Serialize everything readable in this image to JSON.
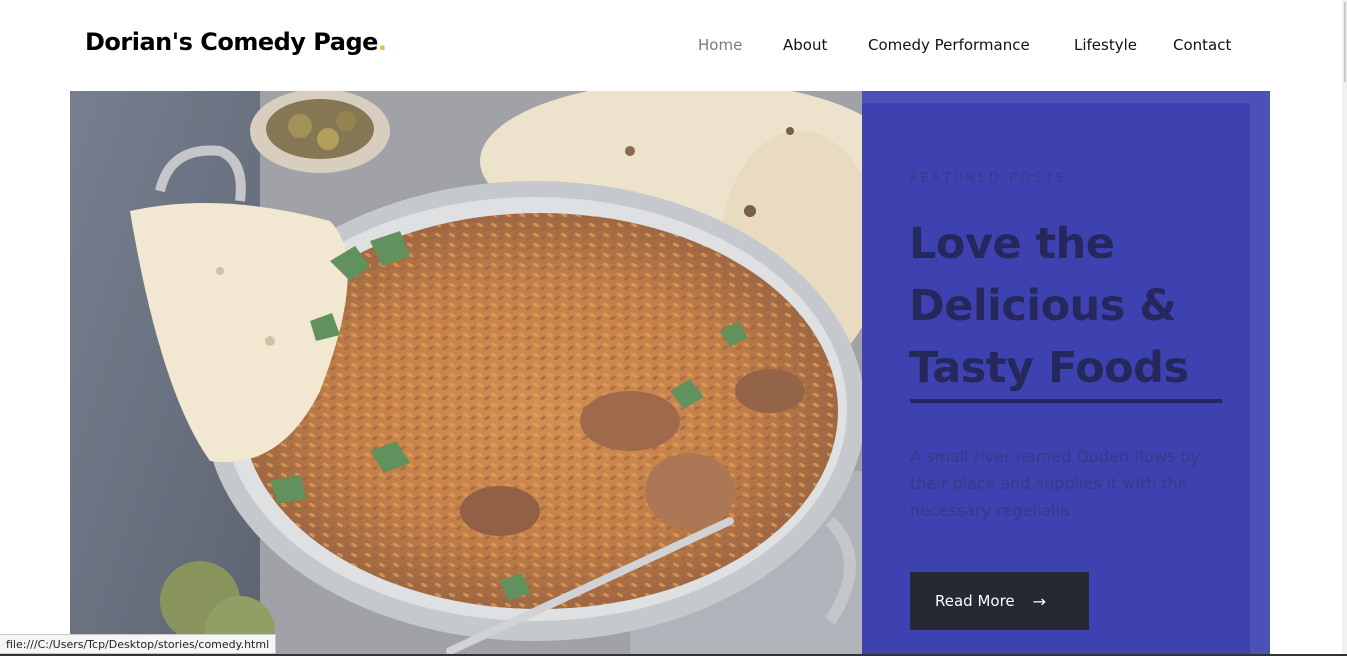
{
  "brand": {
    "name": "Dorian's Comedy Page",
    "dot": ".",
    "dot_color": "#f2c12e"
  },
  "nav": {
    "items": [
      {
        "label": "Home",
        "active": true
      },
      {
        "label": "About"
      },
      {
        "label": "Comedy Performance"
      },
      {
        "label": "Lifestyle"
      },
      {
        "label": "Contact"
      }
    ]
  },
  "hero": {
    "image": "food-pan-image",
    "featured": {
      "eyebrow": "Featured Posts",
      "headline": "Love the Delicious & Tasty Foods",
      "description": "A small river named Duden flows by their place and supplies it with the necessary regelialia",
      "button": {
        "label": "Read More",
        "icon": "arrow-right-icon"
      }
    },
    "colors": {
      "panel": "#3d42b0",
      "panel_edge": "#4b51b8",
      "button": "#262833"
    }
  },
  "status_bar": {
    "url": "file:///C:/Users/Tcp/Desktop/stories/comedy.html"
  }
}
